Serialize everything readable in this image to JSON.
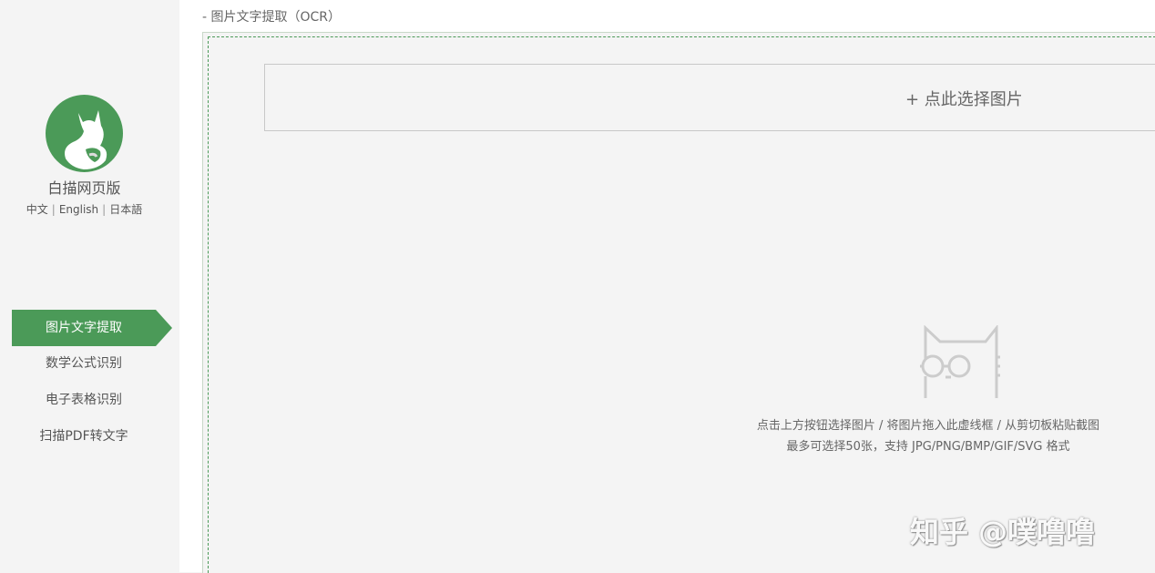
{
  "app": {
    "name": "白描网页版",
    "languages": [
      "中文",
      "English",
      "日本語"
    ],
    "language_separator": "|",
    "brand_color": "#4b9a58"
  },
  "sidebar": {
    "items": [
      {
        "label": "图片文字提取",
        "active": true
      },
      {
        "label": "数学公式识别",
        "active": false
      },
      {
        "label": "电子表格识别",
        "active": false
      },
      {
        "label": "扫描PDF转文字",
        "active": false
      }
    ]
  },
  "main": {
    "breadcrumb": "- 图片文字提取（OCR）",
    "select_button_label": "+ 点此选择图片",
    "hint_line1": "点击上方按钮选择图片 / 将图片拖入此虚线框 / 从剪切板粘贴截图",
    "hint_line2": "最多可选择50张，支持 JPG/PNG/BMP/GIF/SVG 格式",
    "watermark": "知乎 @噗噜噜",
    "icons": {
      "logo": "cat-logo-icon",
      "placeholder": "cat-with-glasses-icon"
    }
  }
}
